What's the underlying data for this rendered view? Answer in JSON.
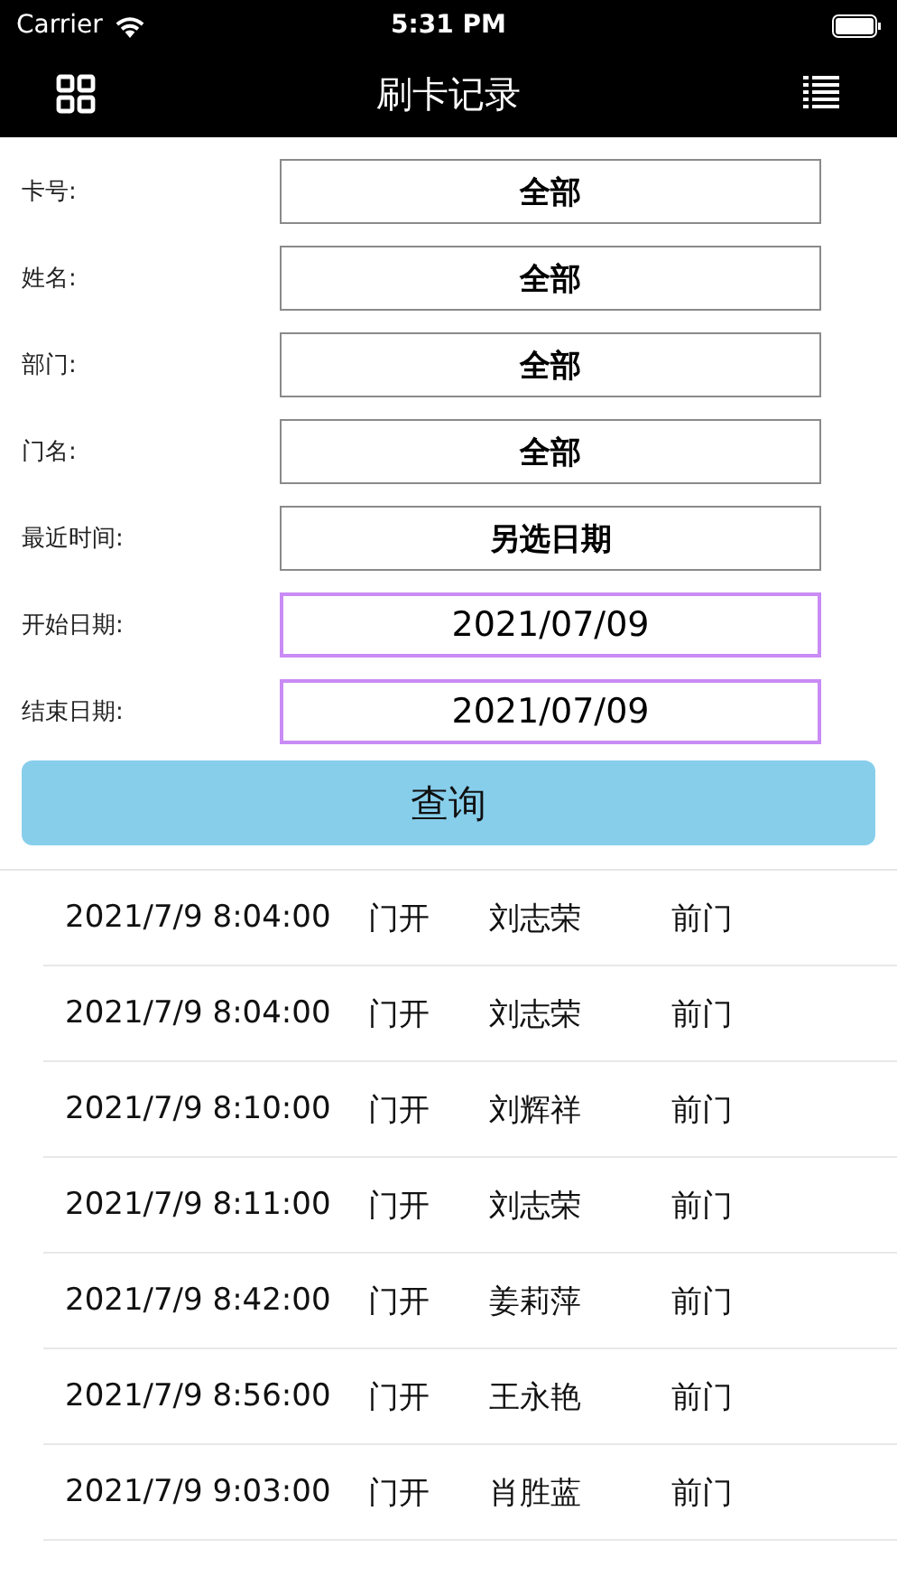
{
  "status_bar": {
    "carrier": "Carrier",
    "time": "5:31 PM"
  },
  "nav_bar": {
    "title": "刷卡记录"
  },
  "filters": [
    {
      "label": "卡号:",
      "value": "全部",
      "kind": "select"
    },
    {
      "label": "姓名:",
      "value": "全部",
      "kind": "select"
    },
    {
      "label": "部门:",
      "value": "全部",
      "kind": "select"
    },
    {
      "label": "门名:",
      "value": "全部",
      "kind": "select"
    },
    {
      "label": "最近时间:",
      "value": "另选日期",
      "kind": "select"
    },
    {
      "label": "开始日期:",
      "value": "2021/07/09",
      "kind": "date"
    },
    {
      "label": "结束日期:",
      "value": "2021/07/09",
      "kind": "date"
    }
  ],
  "query_button": "查询",
  "records": [
    {
      "time": "2021/7/9 8:04:00",
      "event": "门开",
      "name": "刘志荣",
      "door": "前门"
    },
    {
      "time": "2021/7/9 8:04:00",
      "event": "门开",
      "name": "刘志荣",
      "door": "前门"
    },
    {
      "time": "2021/7/9 8:10:00",
      "event": "门开",
      "name": "刘辉祥",
      "door": "前门"
    },
    {
      "time": "2021/7/9 8:11:00",
      "event": "门开",
      "name": "刘志荣",
      "door": "前门"
    },
    {
      "time": "2021/7/9 8:42:00",
      "event": "门开",
      "name": "姜莉萍",
      "door": "前门"
    },
    {
      "time": "2021/7/9 8:56:00",
      "event": "门开",
      "name": "王永艳",
      "door": "前门"
    },
    {
      "time": "2021/7/9 9:03:00",
      "event": "门开",
      "name": "肖胜蓝",
      "door": "前门"
    }
  ]
}
